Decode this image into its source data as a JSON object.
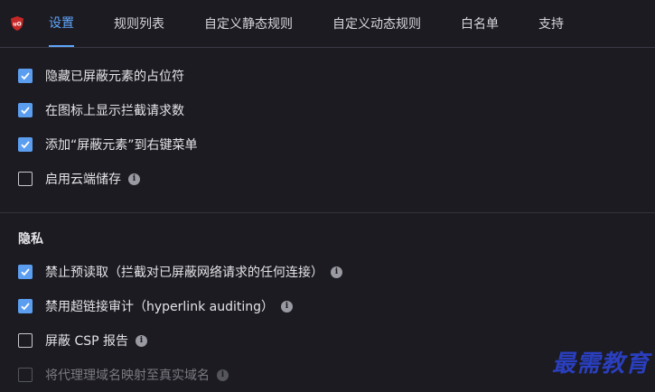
{
  "tabs": [
    {
      "label": "设置",
      "active": true
    },
    {
      "label": "规则列表"
    },
    {
      "label": "自定义静态规则"
    },
    {
      "label": "自定义动态规则"
    },
    {
      "label": "白名单"
    },
    {
      "label": "支持"
    }
  ],
  "appearance_options": [
    {
      "label": "隐藏已屏蔽元素的占位符",
      "checked": true
    },
    {
      "label": "在图标上显示拦截请求数",
      "checked": true
    },
    {
      "label": "添加“屏蔽元素”到右键菜单",
      "checked": true
    },
    {
      "label": "启用云端储存",
      "checked": false,
      "info_icon": true
    }
  ],
  "privacy": {
    "title": "隐私",
    "options": [
      {
        "label": "禁止预读取（拦截对已屏蔽网络请求的任何连接）",
        "checked": true,
        "info_icon": true
      },
      {
        "label": "禁用超链接审计（hyperlink auditing）",
        "checked": true,
        "info_icon": true
      },
      {
        "label": "屏蔽 CSP 报告",
        "checked": false,
        "info_icon": true
      },
      {
        "label": "将代理理域名映射至真实域名",
        "checked": false,
        "disabled": true,
        "info_icon": true
      }
    ]
  },
  "watermark": "最需教育",
  "colors": {
    "background": "#1c1b22",
    "accent": "#60a5fa",
    "checkbox_checked": "#5b9ef0",
    "logo_red": "#d32f2f",
    "watermark": "#2a3fbf"
  },
  "icons": {
    "logo": "ublock-shield-icon",
    "info": "info-icon",
    "check": "check-icon"
  }
}
